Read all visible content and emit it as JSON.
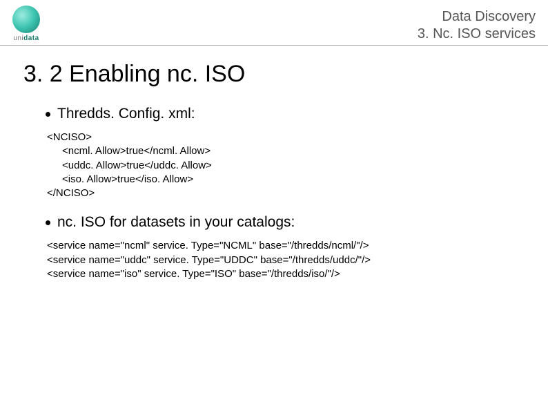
{
  "header": {
    "logo_text_left": "uni",
    "logo_text_right": "data",
    "right_line1": "Data Discovery",
    "right_line2": "3. Nc. ISO services"
  },
  "title": "3. 2 Enabling nc. ISO",
  "bullets": [
    "Thredds. Config. xml:",
    "nc. ISO for datasets in your catalogs:"
  ],
  "code1": {
    "open": "<NCISO>",
    "l1": "<ncml. Allow>true</ncml. Allow>",
    "l2": "<uddc. Allow>true</uddc. Allow>",
    "l3": "<iso. Allow>true</iso. Allow>",
    "close": "</NCISO>"
  },
  "code2": {
    "l1": "<service name=\"ncml\" service. Type=\"NCML\" base=\"/thredds/ncml/\"/>",
    "l2": "<service name=\"uddc\" service. Type=\"UDDC\" base=\"/thredds/uddc/\"/>",
    "l3": "<service name=\"iso\" service. Type=\"ISO\" base=\"/thredds/iso/\"/>"
  }
}
